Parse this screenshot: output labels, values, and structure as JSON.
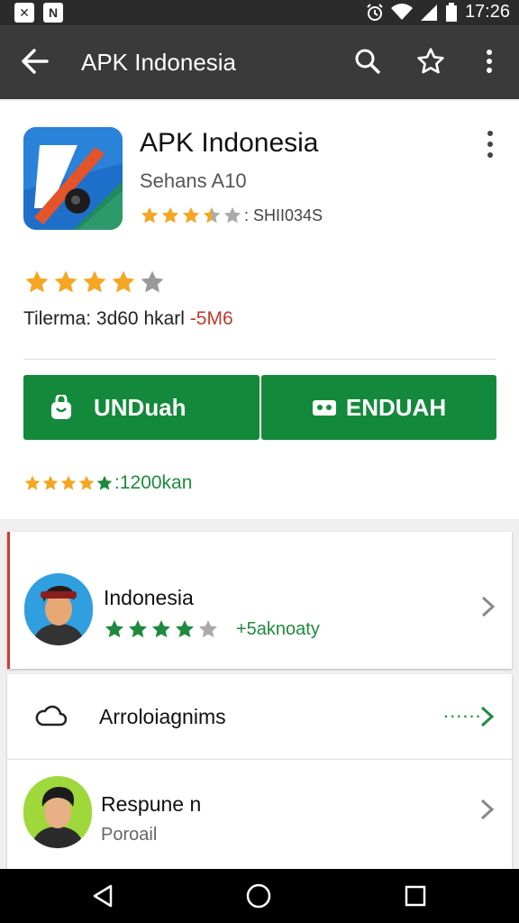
{
  "status_bar": {
    "time": "17:26",
    "left_icons": [
      "app-notification-icon",
      "news-notification-icon"
    ],
    "right_icons": [
      "alarm-icon",
      "wifi-icon",
      "signal-icon",
      "battery-icon"
    ]
  },
  "toolbar": {
    "title": "APK Indonesia",
    "back_icon": "back-arrow-icon",
    "actions": [
      "search-icon",
      "star-icon",
      "more-vert-icon"
    ]
  },
  "app": {
    "name": "APK Indonesia",
    "developer": "Sehans A10",
    "header_rating": 3.5,
    "header_rating_text": ": SHII034S",
    "large_rating": 4,
    "downloads_text": "Tilerma: 3d60 hkarl",
    "downloads_size": "-5M6"
  },
  "buttons": {
    "primary_label": "UNDuah",
    "secondary_label": "ENDUAH"
  },
  "rating_summary": {
    "stars": 4,
    "text": ":1200kan"
  },
  "list": [
    {
      "title": "Indonesia",
      "rating": 4,
      "sub": "+5aknoaty"
    },
    {
      "title": "Arroloiagnims",
      "action_text": "......"
    },
    {
      "title": "Respune n",
      "sub": "Poroail"
    }
  ],
  "colors": {
    "green": "#13893b",
    "star": "#f5a623",
    "dark_bar": "#3a3a3a",
    "accent_red": "#d23b2e"
  },
  "nav": [
    "back-triangle-icon",
    "home-circle-icon",
    "recents-square-icon"
  ]
}
